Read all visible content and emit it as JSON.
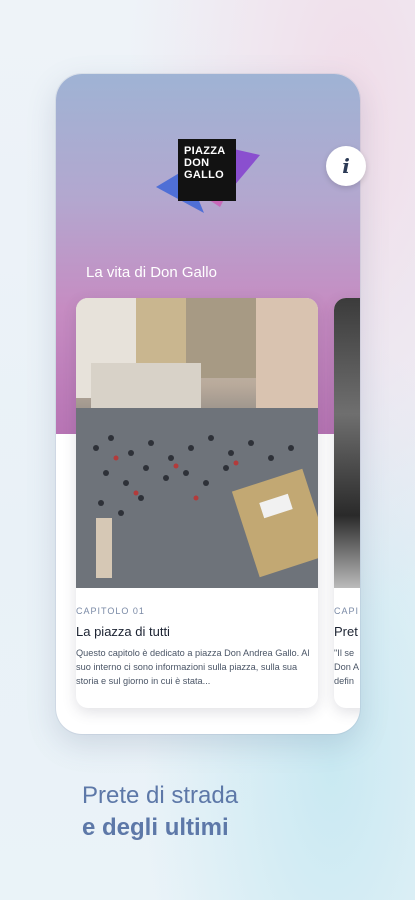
{
  "logo": {
    "lines": [
      "PIAZZA",
      "DON",
      "GALLO"
    ]
  },
  "info_button": {
    "label": "i"
  },
  "section_title": "La vita di Don Gallo",
  "cards": [
    {
      "chapter": "CAPITOLO 01",
      "title": "La piazza di tutti",
      "description": "Questo capitolo è dedicato a piazza Don Andrea Gallo. Al suo interno ci sono informazioni sulla piazza, sulla sua storia e sul giorno in cui è stata..."
    },
    {
      "chapter": "CAPI",
      "title": "Pret",
      "description_lines": [
        "\"Il se",
        "Don A",
        "defin"
      ]
    }
  ],
  "tagline": {
    "line1": "Prete di strada",
    "line2": "e degli ultimi"
  },
  "colors": {
    "accent": "#5d78a8",
    "hero_top": "#9fb3d4",
    "hero_bottom": "#b774b4",
    "logo_bg": "#121212"
  }
}
